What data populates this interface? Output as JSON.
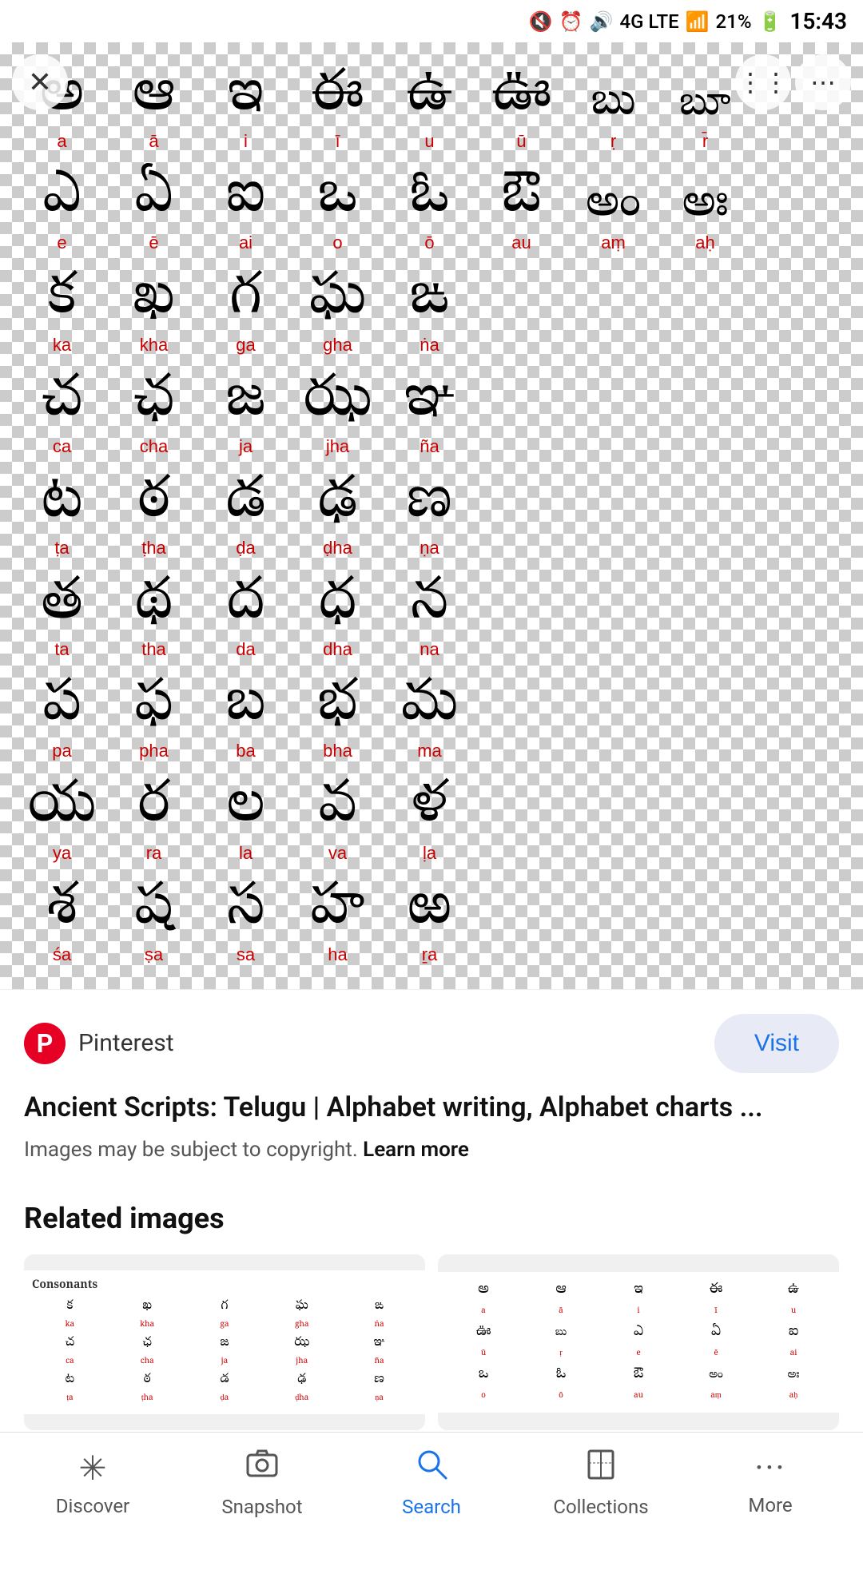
{
  "status_bar": {
    "time": "15:43",
    "battery": "21%",
    "network": "4G LTE"
  },
  "image": {
    "source": "Pinterest",
    "title": "Ancient Scripts: Telugu | Alphabet writing, Alphabet charts ...",
    "copyright_text": "Images may be subject to copyright.",
    "learn_more": "Learn more"
  },
  "visit_button": "Visit",
  "related": {
    "title": "Related images"
  },
  "telugu_vowels": [
    {
      "char": "అ",
      "roman": "a"
    },
    {
      "char": "ఆ",
      "roman": "ā"
    },
    {
      "char": "ఇ",
      "roman": "i"
    },
    {
      "char": "ఈ",
      "roman": "ī"
    },
    {
      "char": "ఉ",
      "roman": "u"
    },
    {
      "char": "ఊ",
      "roman": "ū"
    },
    {
      "char": "బు",
      "roman": "ṛ"
    },
    {
      "char": "బూ",
      "roman": "r̄"
    }
  ],
  "telugu_vowels2": [
    {
      "char": "ఎ",
      "roman": "e"
    },
    {
      "char": "ఏ",
      "roman": "ē"
    },
    {
      "char": "ఐ",
      "roman": "ai"
    },
    {
      "char": "ఒ",
      "roman": "o"
    },
    {
      "char": "ఓ",
      "roman": "ō"
    },
    {
      "char": "ఔ",
      "roman": "au"
    },
    {
      "char": "అం",
      "roman": "aṃ"
    },
    {
      "char": "అః",
      "roman": "aḥ"
    }
  ],
  "telugu_consonants": [
    [
      {
        "char": "క",
        "roman": "ka"
      },
      {
        "char": "ఖ",
        "roman": "kha"
      },
      {
        "char": "గ",
        "roman": "ga"
      },
      {
        "char": "ఘ",
        "roman": "gha"
      },
      {
        "char": "ఙ",
        "roman": "ṅa"
      }
    ],
    [
      {
        "char": "చ",
        "roman": "ca"
      },
      {
        "char": "ఛ",
        "roman": "cha"
      },
      {
        "char": "జ",
        "roman": "ja"
      },
      {
        "char": "ఝ",
        "roman": "jha"
      },
      {
        "char": "ఞ",
        "roman": "ña"
      }
    ],
    [
      {
        "char": "ట",
        "roman": "ṭa"
      },
      {
        "char": "ఠ",
        "roman": "ṭha"
      },
      {
        "char": "డ",
        "roman": "ḍa"
      },
      {
        "char": "ఢ",
        "roman": "ḍha"
      },
      {
        "char": "ణ",
        "roman": "ṇa"
      }
    ],
    [
      {
        "char": "త",
        "roman": "ta"
      },
      {
        "char": "థ",
        "roman": "tha"
      },
      {
        "char": "ద",
        "roman": "da"
      },
      {
        "char": "ధ",
        "roman": "dha"
      },
      {
        "char": "న",
        "roman": "na"
      }
    ],
    [
      {
        "char": "ప",
        "roman": "pa"
      },
      {
        "char": "ఫ",
        "roman": "pha"
      },
      {
        "char": "బ",
        "roman": "ba"
      },
      {
        "char": "భ",
        "roman": "bha"
      },
      {
        "char": "మ",
        "roman": "ma"
      }
    ],
    [
      {
        "char": "య",
        "roman": "ya"
      },
      {
        "char": "ర",
        "roman": "ra"
      },
      {
        "char": "ల",
        "roman": "la"
      },
      {
        "char": "వ",
        "roman": "va"
      },
      {
        "char": "ళ",
        "roman": "ḷa"
      }
    ],
    [
      {
        "char": "శ",
        "roman": "śa"
      },
      {
        "char": "ష",
        "roman": "ṣa"
      },
      {
        "char": "స",
        "roman": "sa"
      },
      {
        "char": "హ",
        "roman": "ha"
      },
      {
        "char": "ఱ",
        "roman": "ṟa"
      }
    ]
  ],
  "nav": {
    "items": [
      {
        "label": "Discover",
        "icon": "✳",
        "active": false
      },
      {
        "label": "Snapshot",
        "icon": "📷",
        "active": false
      },
      {
        "label": "Search",
        "icon": "🔍",
        "active": true
      },
      {
        "label": "Collections",
        "icon": "🔖",
        "active": false
      },
      {
        "label": "More",
        "icon": "···",
        "active": false
      }
    ]
  },
  "close_icon": "✕",
  "share_icon": "⋮",
  "more_icon": "⋮"
}
